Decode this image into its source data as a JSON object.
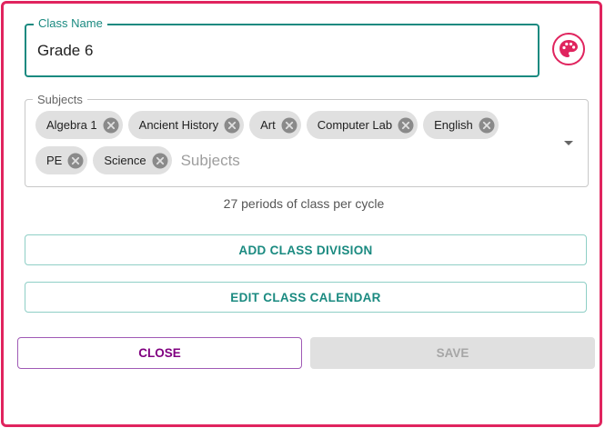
{
  "class_name": {
    "label": "Class Name",
    "value": "Grade 6"
  },
  "palette": {
    "icon": "palette-icon",
    "color": "#e0245e"
  },
  "subjects": {
    "label": "Subjects",
    "placeholder": "Subjects",
    "chips": [
      {
        "label": "Algebra 1"
      },
      {
        "label": "Ancient History"
      },
      {
        "label": "Art"
      },
      {
        "label": "Computer Lab"
      },
      {
        "label": "English"
      },
      {
        "label": "PE"
      },
      {
        "label": "Science"
      }
    ]
  },
  "periods_text": "27 periods of class per cycle",
  "buttons": {
    "add_division": "ADD CLASS DIVISION",
    "edit_calendar": "EDIT CLASS CALENDAR",
    "close": "CLOSE",
    "save": "SAVE"
  },
  "colors": {
    "accent": "#1a8a80",
    "frame": "#e0245e",
    "close": "#800080",
    "disabled": "#e0e0e0"
  }
}
